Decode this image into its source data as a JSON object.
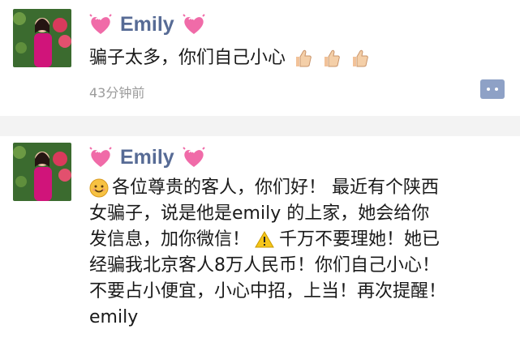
{
  "posts": [
    {
      "author": "Emily",
      "text": "骗子太多，你们自己小心",
      "timestamp": "43分钟前",
      "reactions": [
        "thumbs-up-icon",
        "thumbs-up-icon",
        "thumbs-up-icon"
      ]
    },
    {
      "author": "Emily",
      "lines": [
        "各位尊贵的客人，你们好！ 最近有个陕西",
        "女骗子，说是他是emily 的上家，她会给你",
        "发信息，加你微信！",
        "千万不要理她！她已",
        "经骗我北京客人8万人民币！你们自己小心！",
        "不要占小便宜，小心中招，上当！再次提醒！",
        "emily"
      ]
    }
  ],
  "colors": {
    "name": "#576b95",
    "heart": "#f06ba8",
    "comment_button": "#8ea1c6",
    "timestamp": "#9b9b9b"
  }
}
